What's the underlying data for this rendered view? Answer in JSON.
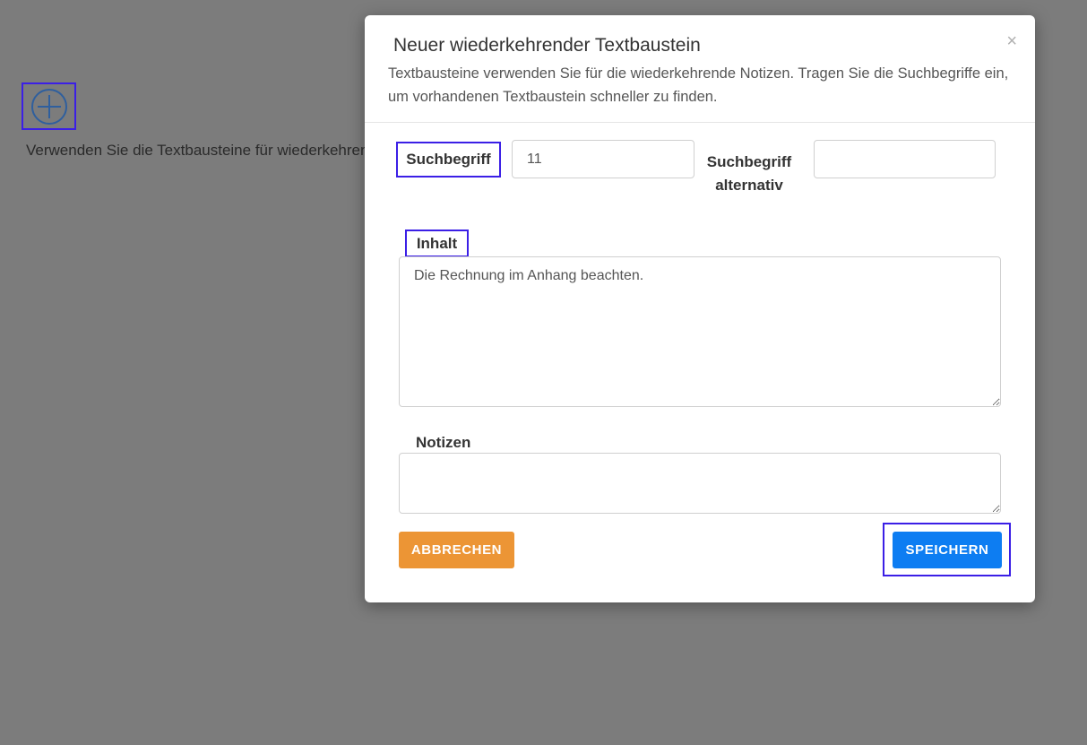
{
  "background": {
    "description_text": "Verwenden Sie die Textbausteine für wiederkehrende"
  },
  "modal": {
    "title": "Neuer wiederkehrender Textbaustein",
    "description": "Textbausteine verwenden Sie für die wiederkehrende Notizen. Tragen Sie die Suchbegriffe ein, um vorhandenen Textbaustein schneller zu finden.",
    "close_symbol": "×",
    "form": {
      "search_term_label": "Suchbegriff",
      "search_term_value": "11",
      "alt_search_term_label_line1": "Suchbegriff",
      "alt_search_term_label_line2": "alternativ",
      "alt_search_term_value": "",
      "content_label": "Inhalt",
      "content_value": "Die Rechnung im Anhang beachten.",
      "notes_label": "Notizen",
      "notes_value": ""
    },
    "buttons": {
      "cancel_label": "ABBRECHEN",
      "save_label": "SPEICHERN"
    }
  },
  "colors": {
    "overlay": "#7c7c7c",
    "cancel_button": "#ec9535",
    "save_button": "#0d7df2",
    "highlight": "#3b1fe6",
    "add_icon": "#2f5f9e"
  },
  "icons": {
    "add": "plus-circle-icon",
    "close": "close-icon"
  }
}
